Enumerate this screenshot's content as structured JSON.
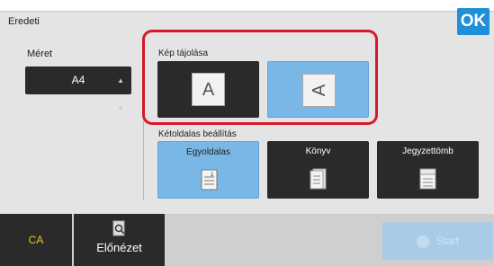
{
  "header": {
    "title": "Eredeti",
    "ok_label": "OK"
  },
  "size": {
    "label": "Méret",
    "value": "A4"
  },
  "orientation": {
    "label": "Kép tájolása",
    "options": [
      {
        "glyph": "A",
        "selected": false
      },
      {
        "glyph": "A",
        "selected": true
      }
    ]
  },
  "duplex": {
    "label": "Kétoldalas beállítás",
    "options": [
      {
        "label": "Egyoldalas",
        "selected": true
      },
      {
        "label": "Könyv",
        "selected": false
      },
      {
        "label": "Jegyzettömb",
        "selected": false
      }
    ]
  },
  "footer": {
    "ca_label": "CA",
    "preview_label": "Előnézet",
    "start_label": "Start"
  },
  "colors": {
    "accent": "#1f8fd8",
    "selected": "#79b8e6",
    "highlight": "#d8182a",
    "ca_text": "#f3c419"
  }
}
